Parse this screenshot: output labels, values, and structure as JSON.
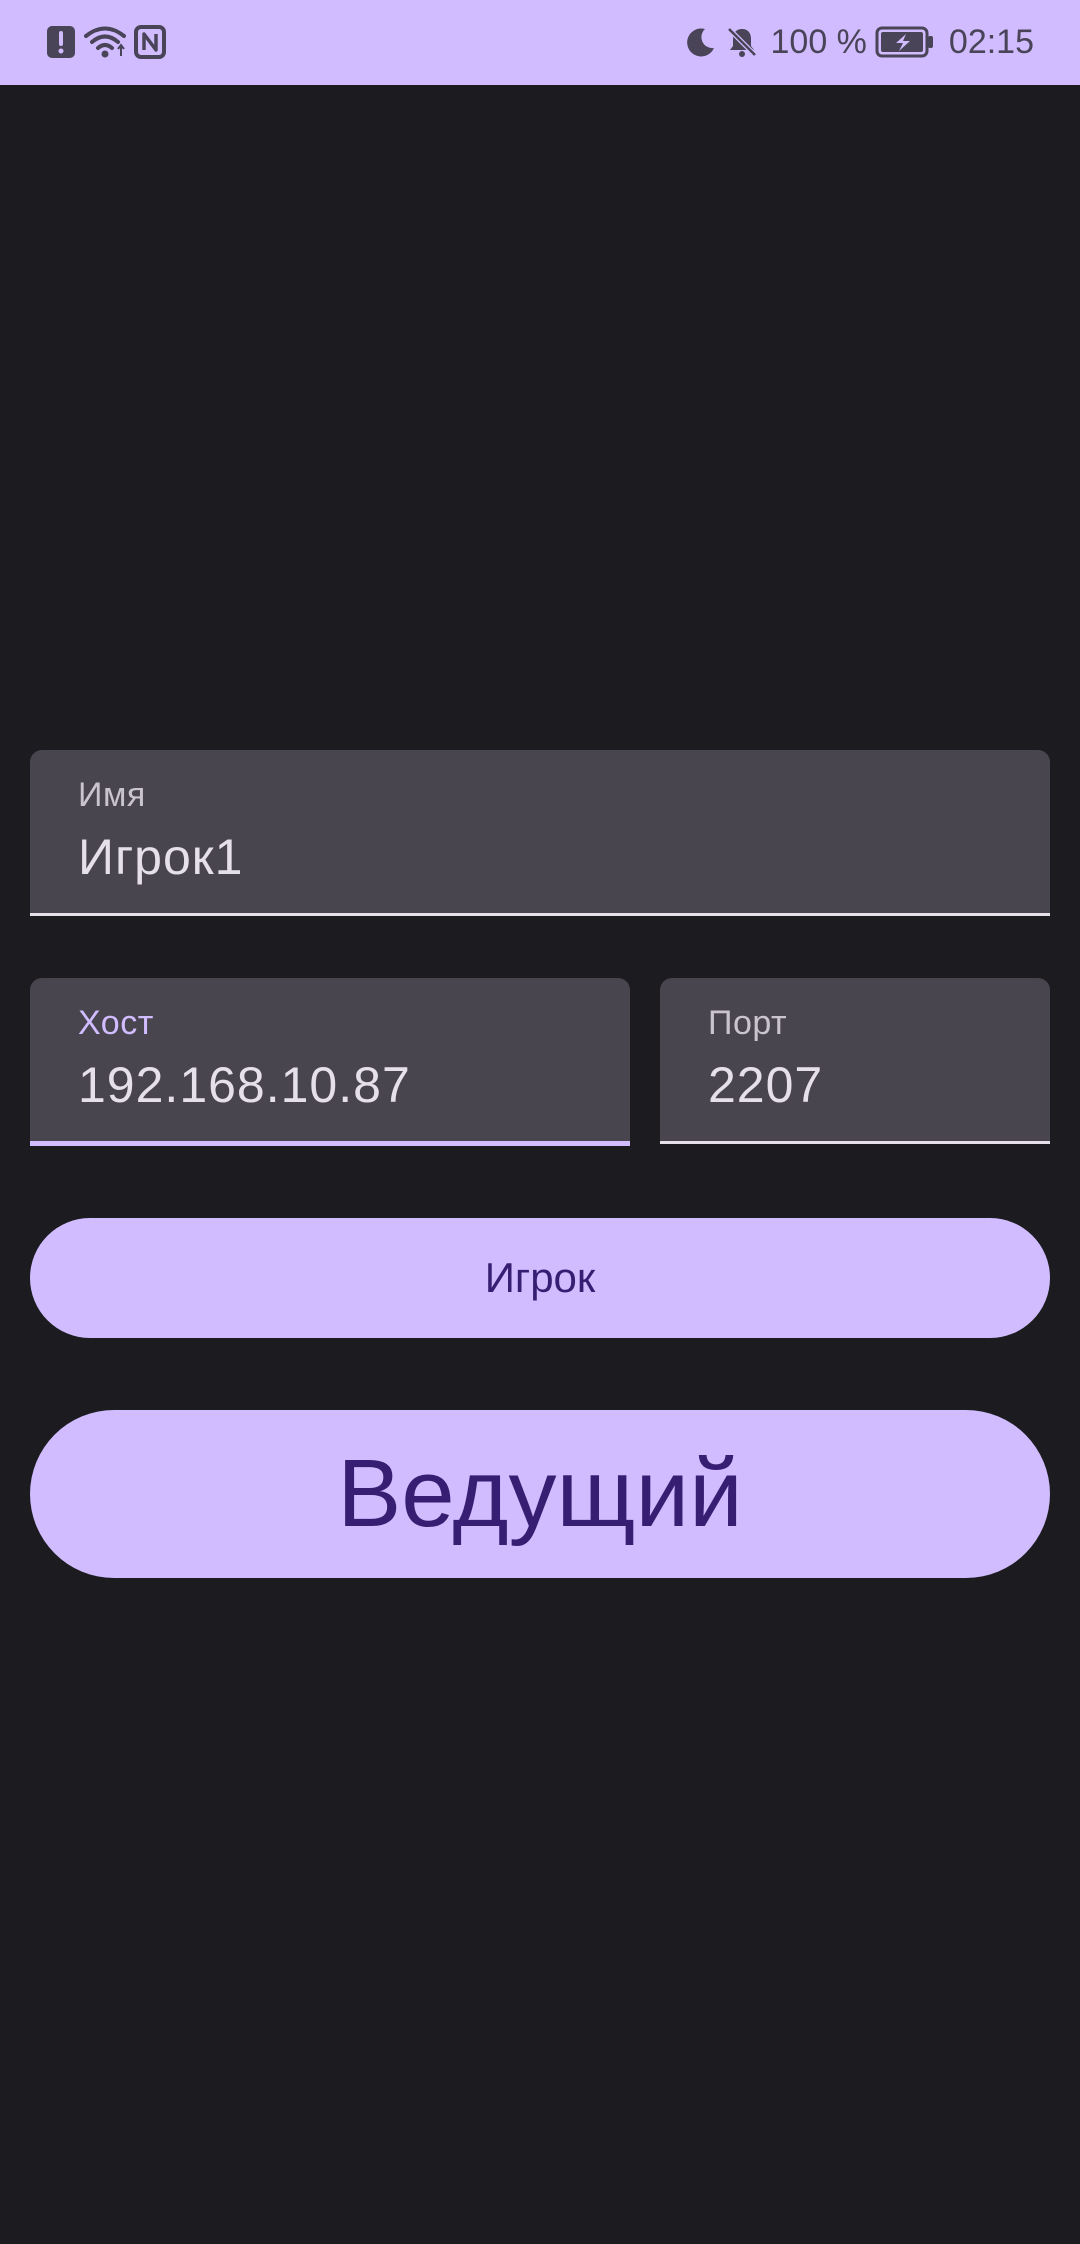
{
  "status_bar": {
    "icons_left": [
      "alert-icon",
      "wifi-icon",
      "nfc-icon"
    ],
    "icons_right": [
      "do-not-disturb-moon-icon",
      "notifications-off-icon",
      "battery-charging-icon"
    ],
    "battery_percent": "100 %",
    "time": "02:15"
  },
  "form": {
    "name": {
      "label": "Имя",
      "value": "Игрок1"
    },
    "host": {
      "label": "Хост",
      "value": "192.168.10.87"
    },
    "port": {
      "label": "Порт",
      "value": "2207"
    }
  },
  "buttons": {
    "player_label": "Игрок",
    "host_label": "Ведущий"
  },
  "colors": {
    "background": "#1c1b1f",
    "accent": "#d0bcff",
    "field_background": "#49454f",
    "button_text": "#381e72"
  }
}
